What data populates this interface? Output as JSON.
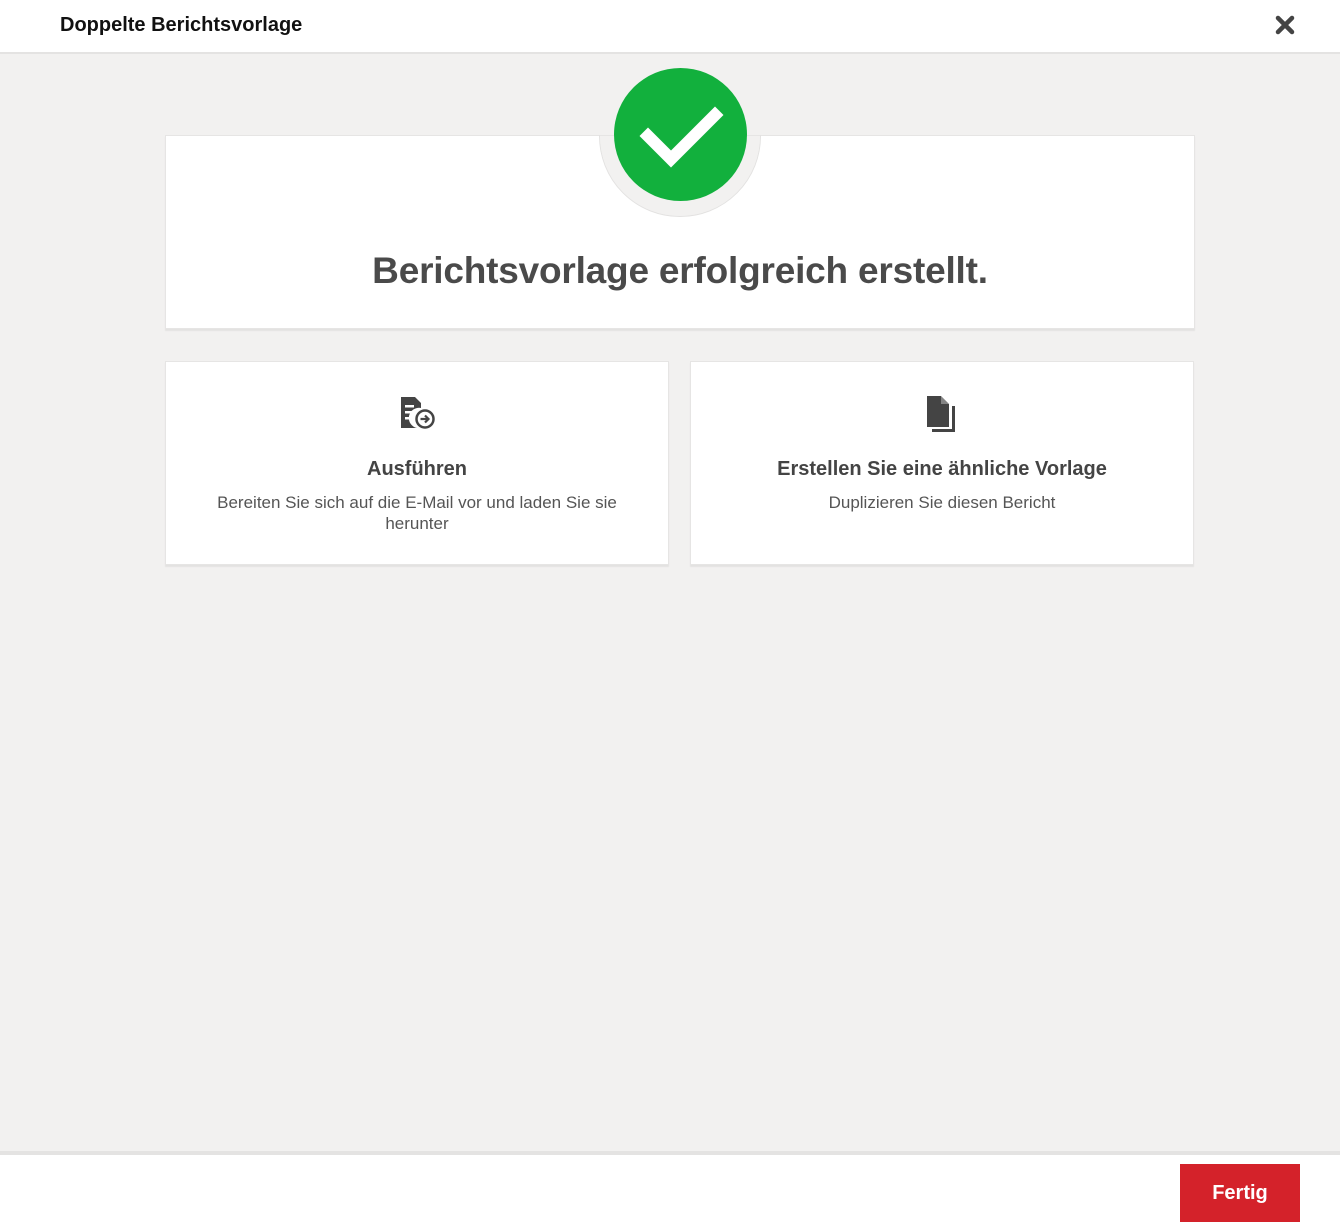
{
  "dialog": {
    "title": "Doppelte Berichtsvorlage"
  },
  "success": {
    "message": "Berichtsvorlage erfolgreich erstellt.",
    "accent_color": "#12b03d"
  },
  "actions": [
    {
      "title": "Ausführen",
      "description": "Bereiten Sie sich auf die E-Mail vor und laden Sie sie herunter",
      "icon": "run-report-icon"
    },
    {
      "title": "Erstellen Sie eine ähnliche Vorlage",
      "description": "Duplizieren Sie diesen Bericht",
      "icon": "duplicate-document-icon"
    }
  ],
  "footer": {
    "done_label": "Fertig",
    "button_color": "#d4222a"
  }
}
